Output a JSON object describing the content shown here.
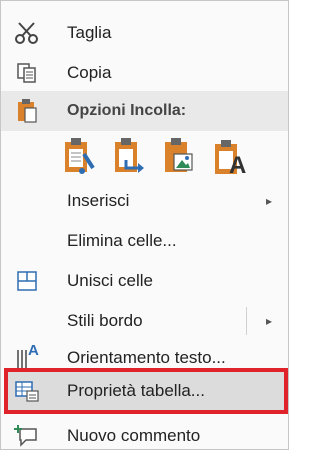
{
  "menu": {
    "cut": {
      "label": "Taglia",
      "icon": "scissors-icon"
    },
    "copy": {
      "label": "Copia",
      "icon": "copy-icon"
    },
    "paste_options": {
      "label": "Opzioni Incolla:",
      "icon": "clipboard-icon",
      "buttons": [
        {
          "name": "paste-keep-formatting-button",
          "icon": "paste-brush-icon"
        },
        {
          "name": "paste-merge-button",
          "icon": "paste-arrow-icon"
        },
        {
          "name": "paste-picture-button",
          "icon": "paste-picture-icon"
        },
        {
          "name": "paste-text-only-button",
          "icon": "paste-text-icon",
          "glyph": "A"
        }
      ]
    },
    "insert": {
      "label": "Inserisci"
    },
    "delete_cells": {
      "label": "Elimina celle..."
    },
    "merge_cells": {
      "label": "Unisci celle",
      "icon": "merge-cells-icon"
    },
    "border_styles": {
      "label": "Stili bordo"
    },
    "text_direction": {
      "label": "Orientamento testo...",
      "icon": "text-direction-icon",
      "glyph": "A"
    },
    "table_properties": {
      "label": "Proprietà tabella...",
      "icon": "table-properties-icon"
    },
    "new_comment": {
      "label": "Nuovo commento",
      "icon": "new-comment-icon"
    },
    "submenu_arrow": "▸"
  },
  "colors": {
    "highlight_border": "#e0232a",
    "icon_orange": "#d9812b",
    "icon_blue": "#2f6db3",
    "icon_green": "#2e8b57"
  }
}
